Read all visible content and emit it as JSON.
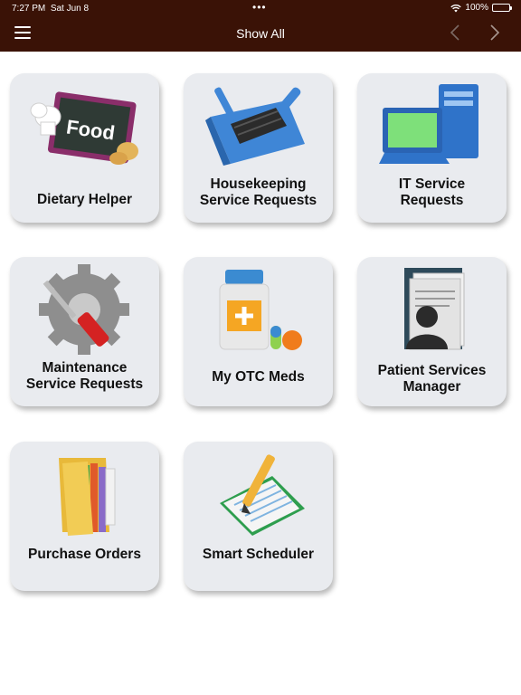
{
  "status_bar": {
    "time": "7:27 PM",
    "date": "Sat Jun 8",
    "battery": "100%",
    "battery_level": 1.0
  },
  "nav": {
    "title": "Show All",
    "menu_icon": "hamburger-menu-icon",
    "back_icon": "chevron-left-icon",
    "forward_icon": "chevron-right-icon"
  },
  "colors": {
    "nav_background": "#3a1206",
    "tile_background": "#e9ebef",
    "page_background": "#ffffff"
  },
  "tiles": [
    {
      "label": "Dietary Helper",
      "icon": "food-chalkboard-icon",
      "icon_text": "Food"
    },
    {
      "label": "Housekeeping\nService Requests",
      "icon": "dustpan-brush-icon"
    },
    {
      "label": "IT Service\nRequests",
      "icon": "computer-icon"
    },
    {
      "label": "Maintenance\nService Requests",
      "icon": "gear-screwdriver-icon"
    },
    {
      "label": "My OTC Meds",
      "icon": "medicine-bottle-pills-icon"
    },
    {
      "label": "Patient Services\nManager",
      "icon": "patient-file-icon"
    },
    {
      "label": "Purchase Orders",
      "icon": "folder-documents-icon"
    },
    {
      "label": "Smart Scheduler",
      "icon": "notebook-pencil-icon"
    }
  ]
}
